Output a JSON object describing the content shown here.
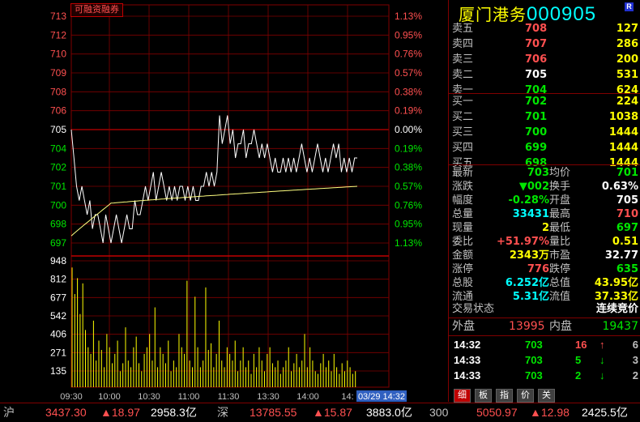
{
  "stock": {
    "name": "厦门港务",
    "code": "000905",
    "tag": "R"
  },
  "margin_badge": "可融资融券",
  "chart_data": {
    "type": "line",
    "price_axis": [
      "713",
      "712",
      "710",
      "709",
      "708",
      "706",
      "705",
      "704",
      "702",
      "701",
      "700",
      "698",
      "697"
    ],
    "pct_axis": [
      "1.13%",
      "0.95%",
      "0.76%",
      "0.57%",
      "0.38%",
      "0.19%",
      "0.00%",
      "0.19%",
      "0.38%",
      "0.57%",
      "0.76%",
      "0.95%",
      "1.13%"
    ],
    "volume_axis": [
      "948",
      "812",
      "677",
      "542",
      "406",
      "271",
      "135"
    ],
    "time_axis": [
      "09:30",
      "10:00",
      "10:30",
      "11:00",
      "11:30",
      "13:30",
      "14:00",
      "14:"
    ],
    "cursor_label": "03/29 14:32",
    "prev_close": 7.05,
    "price_min": 6.97,
    "price_max": 7.13,
    "price_series": [
      7.05,
      7.03,
      7.01,
      7.0,
      7.01,
      7.0,
      6.99,
      7.0,
      6.98,
      6.99,
      6.99,
      6.98,
      6.97,
      6.99,
      6.98,
      6.97,
      6.98,
      6.99,
      6.98,
      6.97,
      6.98,
      6.99,
      6.98,
      6.98,
      7.0,
      6.99,
      6.99,
      7.0,
      7.01,
      7.0,
      7.01,
      7.02,
      7.0,
      7.01,
      7.02,
      7.01,
      7.0,
      7.01,
      7.0,
      7.01,
      7.0,
      7.01,
      7.01,
      7.0,
      7.01,
      7.0,
      7.01,
      7.0,
      7.0,
      7.01,
      7.01,
      7.02,
      7.01,
      7.02,
      7.01,
      7.02,
      7.06,
      7.04,
      7.05,
      7.06,
      7.04,
      7.05,
      7.03,
      7.04,
      7.04,
      7.05,
      7.03,
      7.04,
      7.04,
      7.05,
      7.04,
      7.03,
      7.04,
      7.03,
      7.04,
      7.03,
      7.02,
      7.03,
      7.02,
      7.02,
      7.03,
      7.02,
      7.03,
      7.02,
      7.03,
      7.02,
      7.03,
      7.04,
      7.03,
      7.02,
      7.03,
      7.02,
      7.03,
      7.04,
      7.03,
      7.02,
      7.03,
      7.02,
      7.03,
      7.04,
      7.03,
      7.04,
      7.02,
      7.03,
      7.02,
      7.03,
      7.02,
      7.03,
      7.03
    ],
    "avg_series_start": 6.995,
    "avg_series_end": 7.01,
    "volume_series": [
      900,
      700,
      820,
      550,
      780,
      430,
      300,
      250,
      500,
      200,
      350,
      280,
      150,
      400,
      300,
      180,
      250,
      350,
      120,
      180,
      450,
      200,
      150,
      300,
      380,
      180,
      120,
      250,
      300,
      400,
      200,
      600,
      150,
      300,
      250,
      180,
      350,
      120,
      200,
      150,
      400,
      300,
      250,
      800,
      200,
      150,
      680,
      300,
      150,
      200,
      750,
      280,
      330,
      150,
      250,
      500,
      200,
      150,
      300,
      250,
      200,
      350,
      120,
      200,
      300,
      150,
      200,
      100,
      250,
      150,
      300,
      200,
      120,
      250,
      300,
      180,
      150,
      200,
      100,
      150,
      200,
      300,
      120,
      180,
      250,
      150,
      200,
      400,
      150,
      300,
      200,
      120,
      100,
      180,
      250,
      150,
      200,
      120,
      250,
      150,
      100,
      180,
      120,
      200,
      150,
      100,
      120
    ]
  },
  "order_book": {
    "asks": [
      {
        "label": "卖五",
        "price": "708",
        "vol": "127"
      },
      {
        "label": "卖四",
        "price": "707",
        "vol": "286"
      },
      {
        "label": "卖三",
        "price": "706",
        "vol": "200"
      },
      {
        "label": "卖二",
        "price": "705",
        "vol": "531"
      },
      {
        "label": "卖一",
        "price": "704",
        "vol": "624"
      }
    ],
    "bids": [
      {
        "label": "买一",
        "price": "702",
        "vol": "224"
      },
      {
        "label": "买二",
        "price": "701",
        "vol": "1038"
      },
      {
        "label": "买三",
        "price": "700",
        "vol": "1444"
      },
      {
        "label": "买四",
        "price": "699",
        "vol": "1444"
      },
      {
        "label": "买五",
        "price": "698",
        "vol": "1444"
      }
    ]
  },
  "stats": [
    {
      "l1": "最新",
      "v1": "703",
      "c1": "grn",
      "l2": "均价",
      "v2": "701",
      "c2": "grn"
    },
    {
      "l1": "涨跌",
      "v1": "▼002",
      "c1": "grn",
      "l2": "换手",
      "v2": "0.63%",
      "c2": "wht"
    },
    {
      "l1": "幅度",
      "v1": "-0.28%",
      "c1": "grn",
      "l2": "开盘",
      "v2": "705",
      "c2": "wht"
    },
    {
      "l1": "总量",
      "v1": "33431",
      "c1": "cyn",
      "l2": "最高",
      "v2": "710",
      "c2": "red"
    },
    {
      "l1": "现量",
      "v1": "2",
      "c1": "yel",
      "l2": "最低",
      "v2": "697",
      "c2": "grn"
    },
    {
      "l1": "委比",
      "v1": "+51.97%",
      "c1": "red",
      "l2": "量比",
      "v2": "0.51",
      "c2": "yel"
    },
    {
      "l1": "金额",
      "v1": "2343万",
      "c1": "yel",
      "l2": "市盈",
      "v2": "32.77",
      "c2": "wht"
    },
    {
      "l1": "涨停",
      "v1": "776",
      "c1": "red",
      "l2": "跌停",
      "v2": "635",
      "c2": "grn"
    },
    {
      "l1": "总股",
      "v1": "6.252亿",
      "c1": "cyn",
      "l2": "总值",
      "v2": "43.95亿",
      "c2": "yel"
    },
    {
      "l1": "流通",
      "v1": "5.31亿",
      "c1": "cyn",
      "l2": "流值",
      "v2": "37.33亿",
      "c2": "yel"
    }
  ],
  "trade_status": {
    "label": "交易状态",
    "value": "连续竞价"
  },
  "outer_inner": {
    "out_label": "外盘",
    "out_val": "13995",
    "in_label": "内盘",
    "in_val": "19437"
  },
  "ticks": [
    {
      "time": "14:32",
      "price": "703",
      "vol": "16",
      "arrow": "↑",
      "acolor": "red",
      "n": "6"
    },
    {
      "time": "14:33",
      "price": "703",
      "vol": "5",
      "arrow": "↓",
      "acolor": "grn",
      "n": "3"
    },
    {
      "time": "14:33",
      "price": "703",
      "vol": "2",
      "arrow": "↓",
      "acolor": "grn",
      "n": "2"
    }
  ],
  "tabs": [
    "细",
    "板",
    "指",
    "价",
    "关"
  ],
  "status_bar": {
    "sh_label": "沪",
    "sh_idx": "3437.30",
    "sh_chg": "▲18.97",
    "sh_amt": "2958.3亿",
    "sz_label": "深",
    "sz_idx": "13785.55",
    "sz_chg": "▲15.87",
    "sz_amt": "3883.0亿",
    "cy_label": "300",
    "cy_idx": "5050.97",
    "cy_chg": "▲12.98",
    "cy_amt": "2425.5亿"
  },
  "colors": {
    "up": "#ff5050",
    "down": "#00e600",
    "grid": "#800000",
    "price_line": "#ffffff",
    "avg_line": "#ffff80",
    "volume": "#ffff00"
  }
}
